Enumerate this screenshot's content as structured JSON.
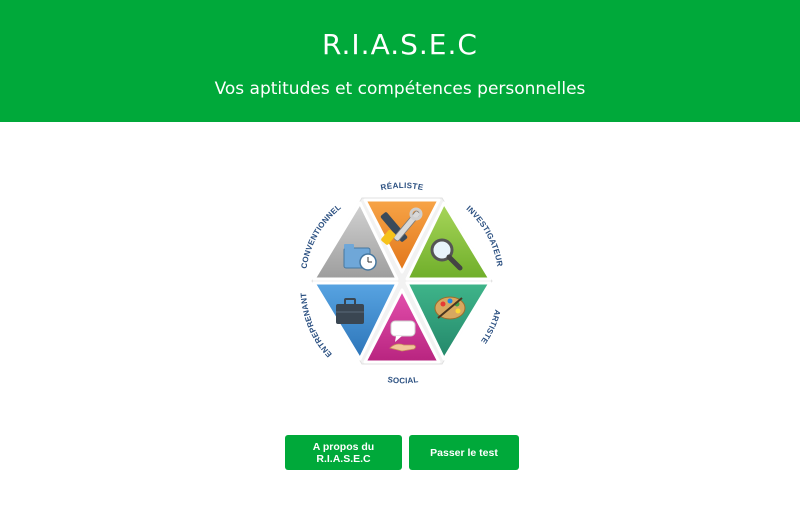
{
  "header": {
    "title": "R.I.A.S.E.C",
    "subtitle": "Vos aptitudes et compétences personnelles"
  },
  "riasec_diagram": {
    "segments": [
      {
        "label": "RÉALISTE",
        "color": "#f08a24",
        "icon": "tools-icon"
      },
      {
        "label": "INVESTIGATEUR",
        "color": "#8cc63f",
        "icon": "magnifier-icon"
      },
      {
        "label": "ARTISTE",
        "color": "#2f9e7a",
        "icon": "palette-icon"
      },
      {
        "label": "SOCIAL",
        "color": "#d6339a",
        "icon": "speech-hand-icon"
      },
      {
        "label": "ENTREPRENANT",
        "color": "#3f8fd2",
        "icon": "briefcase-icon"
      },
      {
        "label": "CONVENTIONNEL",
        "color": "#b5b5b5",
        "icon": "folder-clock-icon"
      }
    ]
  },
  "actions": {
    "about_label": "A propos du R.I.A.S.E.C",
    "test_label": "Passer le test"
  },
  "colors": {
    "brand_green": "#00a93a",
    "label_blue": "#2a4f80"
  }
}
